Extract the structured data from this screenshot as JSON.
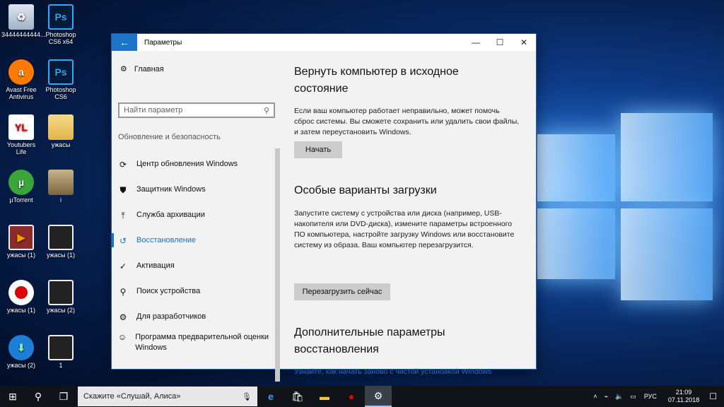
{
  "desktop": {
    "icons": [
      {
        "label": "34444444444...",
        "icon": "recycle-bin-icon"
      },
      {
        "label": "Photoshop CS6 x64",
        "icon": "photoshop-icon"
      },
      {
        "label": "Avast Free Antivirus",
        "icon": "avast-icon"
      },
      {
        "label": "Photoshop CS6",
        "icon": "photoshop-icon"
      },
      {
        "label": "Youtubers Life",
        "icon": "youtubers-life-icon"
      },
      {
        "label": "ужасы",
        "icon": "folder-icon"
      },
      {
        "label": "µTorrent",
        "icon": "utorrent-icon"
      },
      {
        "label": "i",
        "icon": "image-file-icon"
      },
      {
        "label": "ужасы (1)",
        "icon": "video-editor-icon"
      },
      {
        "label": "ужасы (1)",
        "icon": "video-file-icon"
      },
      {
        "label": "ужасы (1)",
        "icon": "screen-recorder-icon"
      },
      {
        "label": "ужасы (2)",
        "icon": "video-file-icon"
      },
      {
        "label": "ужасы (2)",
        "icon": "downloader-icon"
      },
      {
        "label": "1",
        "icon": "video-file-icon"
      }
    ]
  },
  "window": {
    "title": "Параметры",
    "back_icon": "←",
    "minimize": "—",
    "maximize": "☐",
    "close": "✕"
  },
  "sidebar": {
    "home_label": "Главная",
    "search_placeholder": "Найти параметр",
    "section_title": "Обновление и безопасность",
    "items": [
      {
        "label": "Центр обновления Windows",
        "icon": "⟳"
      },
      {
        "label": "Защитник Windows",
        "icon": "⛊"
      },
      {
        "label": "Служба архивации",
        "icon": "⤒"
      },
      {
        "label": "Восстановление",
        "icon": "↺"
      },
      {
        "label": "Активация",
        "icon": "✓"
      },
      {
        "label": "Поиск устройства",
        "icon": "⚲"
      },
      {
        "label": "Для разработчиков",
        "icon": "⚙"
      },
      {
        "label": "Программа предварительной оценки Windows",
        "icon": "☺"
      }
    ]
  },
  "main": {
    "reset_title": "Вернуть компьютер в исходное состояние",
    "reset_desc": "Если ваш компьютер работает неправильно, может помочь сброс системы. Вы сможете сохранить или удалить свои файлы, и затем переустановить Windows.",
    "reset_button": "Начать",
    "advanced_title": "Особые варианты загрузки",
    "advanced_desc": "Запустите систему с устройства или диска (например, USB-накопителя или DVD-диска), измените параметры встроенного ПО компьютера, настройте загрузку Windows или восстановите систему из образа. Ваш компьютер перезагрузится.",
    "advanced_button": "Перезагрузить сейчас",
    "more_title": "Дополнительные параметры восстановления",
    "more_link": "Узнайте, как начать заново с чистой установкой Windows"
  },
  "taskbar": {
    "search_text": "Скажите «Слушай, Алиса»",
    "language": "РУС",
    "time": "21:09",
    "date": "07.11.2018"
  },
  "colors": {
    "accent": "#1e74c8",
    "link": "#1e6fc3"
  }
}
